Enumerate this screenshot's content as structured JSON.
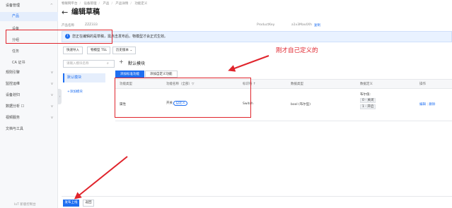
{
  "breadcrumb": [
    "物联网平台",
    "设备管理",
    "产品",
    "产品详情",
    "功能定义"
  ],
  "page": {
    "title": "编辑草稿"
  },
  "meta": {
    "product_name_label": "产品名称",
    "product_name_value": "ZZZ333",
    "product_key_label": "ProductKey",
    "product_key_value": "a1v3Mas4Xh",
    "copy_label": "复制"
  },
  "sidebar": {
    "groups": [
      {
        "label": "设备管理",
        "chevron": "^"
      },
      {
        "label": "产品"
      },
      {
        "label": "设备"
      },
      {
        "label": "分组"
      },
      {
        "label": "任务"
      },
      {
        "label": "CA 证书"
      },
      {
        "label": "规则引擎",
        "chevron": "v"
      },
      {
        "label": "监控运维",
        "chevron": "v"
      },
      {
        "label": "设备划归",
        "chevron": "v"
      },
      {
        "label": "数据分析 ☐",
        "chevron": "v"
      },
      {
        "label": "视频服务",
        "chevron": "v"
      },
      {
        "label": "文档与工具"
      }
    ],
    "footer": "IoT 新版控制台",
    "collapse": "‹"
  },
  "notice": {
    "icon": "i",
    "text": "您正在编辑的是草稿，需点击发布后，物模型才会正式生效。"
  },
  "toolbar": {
    "quick_import": "快速导入",
    "model_tsl": "物模型 TSL",
    "history": "历史版本"
  },
  "annotation": {
    "text": "刚才自己定义的"
  },
  "module_panel": {
    "search_placeholder": "请输入模块名称",
    "search_icon": "⌕",
    "add_icon": "+",
    "section_title": "默认模块",
    "items": [
      "默认模块"
    ],
    "add_module_label": "+添加模块"
  },
  "tabs": [
    "添加标准功能",
    "添加自定义功能"
  ],
  "table": {
    "headers": [
      "功能类型",
      "功能名称（全部）▽",
      "标识符 ↑",
      "数据类型",
      "数据定义",
      "操作"
    ],
    "rows": [
      {
        "type": "属性",
        "name_prefix": "开关",
        "name_pill": "自定义",
        "identifier": "Switch",
        "data_type": "bool (布尔型)",
        "definition_label": "布尔值:",
        "enum_values": [
          "0 - 关闭",
          "1 - 开启"
        ],
        "actions": [
          "编辑",
          "删除"
        ]
      }
    ]
  },
  "bottom": {
    "publish": "发布上线",
    "return": "返回"
  },
  "colors": {
    "primary": "#1f6ff1",
    "annotation_red": "#e0242c"
  }
}
